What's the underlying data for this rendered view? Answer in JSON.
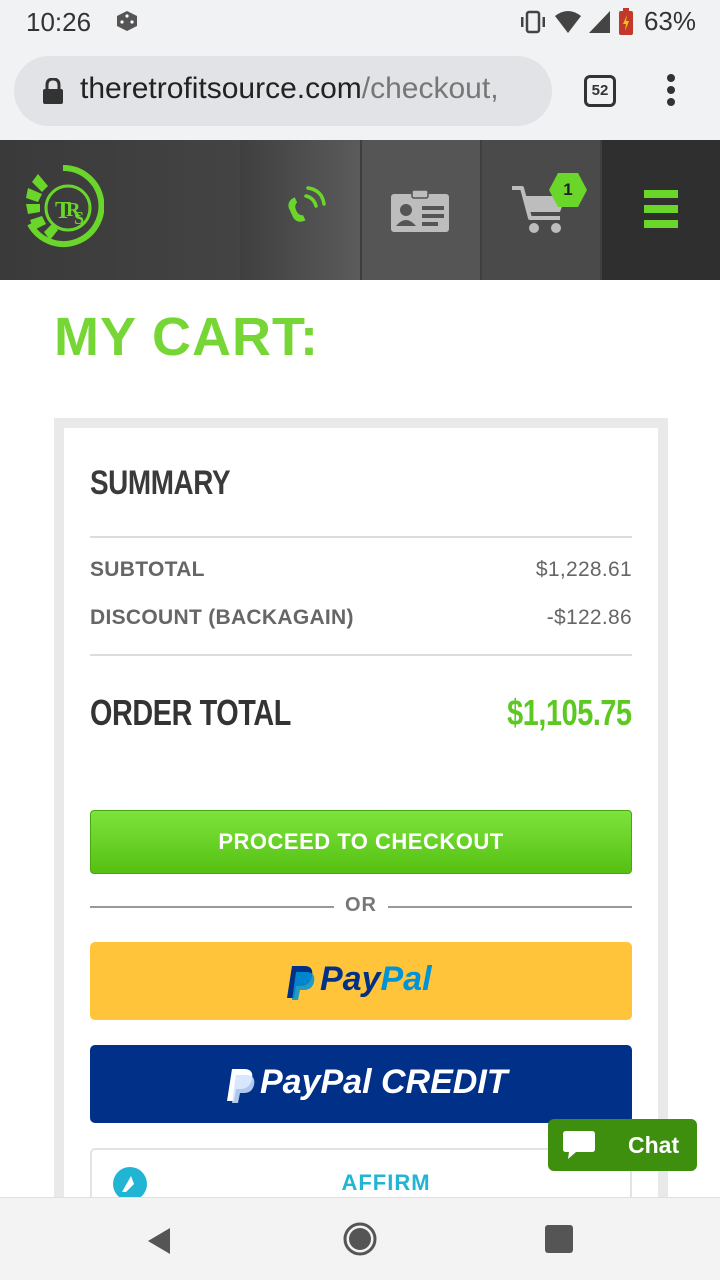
{
  "status_bar": {
    "time": "10:26",
    "battery": "63%"
  },
  "browser": {
    "url_domain": "theretrofitsource.com",
    "url_path": "/checkout,",
    "tab_count": "52"
  },
  "header": {
    "logo_text": "TRS",
    "cart_count": "1"
  },
  "page": {
    "title": "MY CART:"
  },
  "summary": {
    "heading": "SUMMARY",
    "subtotal_label": "SUBTOTAL",
    "subtotal_value": "$1,228.61",
    "discount_label": "DISCOUNT (BACKAGAIN)",
    "discount_value": "-$122.86",
    "total_label": "ORDER TOTAL",
    "total_value": "$1,105.75"
  },
  "actions": {
    "checkout_label": "PROCEED TO CHECKOUT",
    "or_label": "OR",
    "paypal_pay": "Pay",
    "paypal_pal": "Pal",
    "paypal_credit_label": "PayPal CREDIT",
    "affirm_label": "AFFIRM"
  },
  "chat": {
    "label": "Chat"
  },
  "colors": {
    "brand_green": "#76d635",
    "total_green": "#5cc821",
    "paypal_yellow": "#ffc43a",
    "paypal_blue": "#003087",
    "affirm_blue": "#22b5d3",
    "chat_green": "#3e8f0e"
  }
}
